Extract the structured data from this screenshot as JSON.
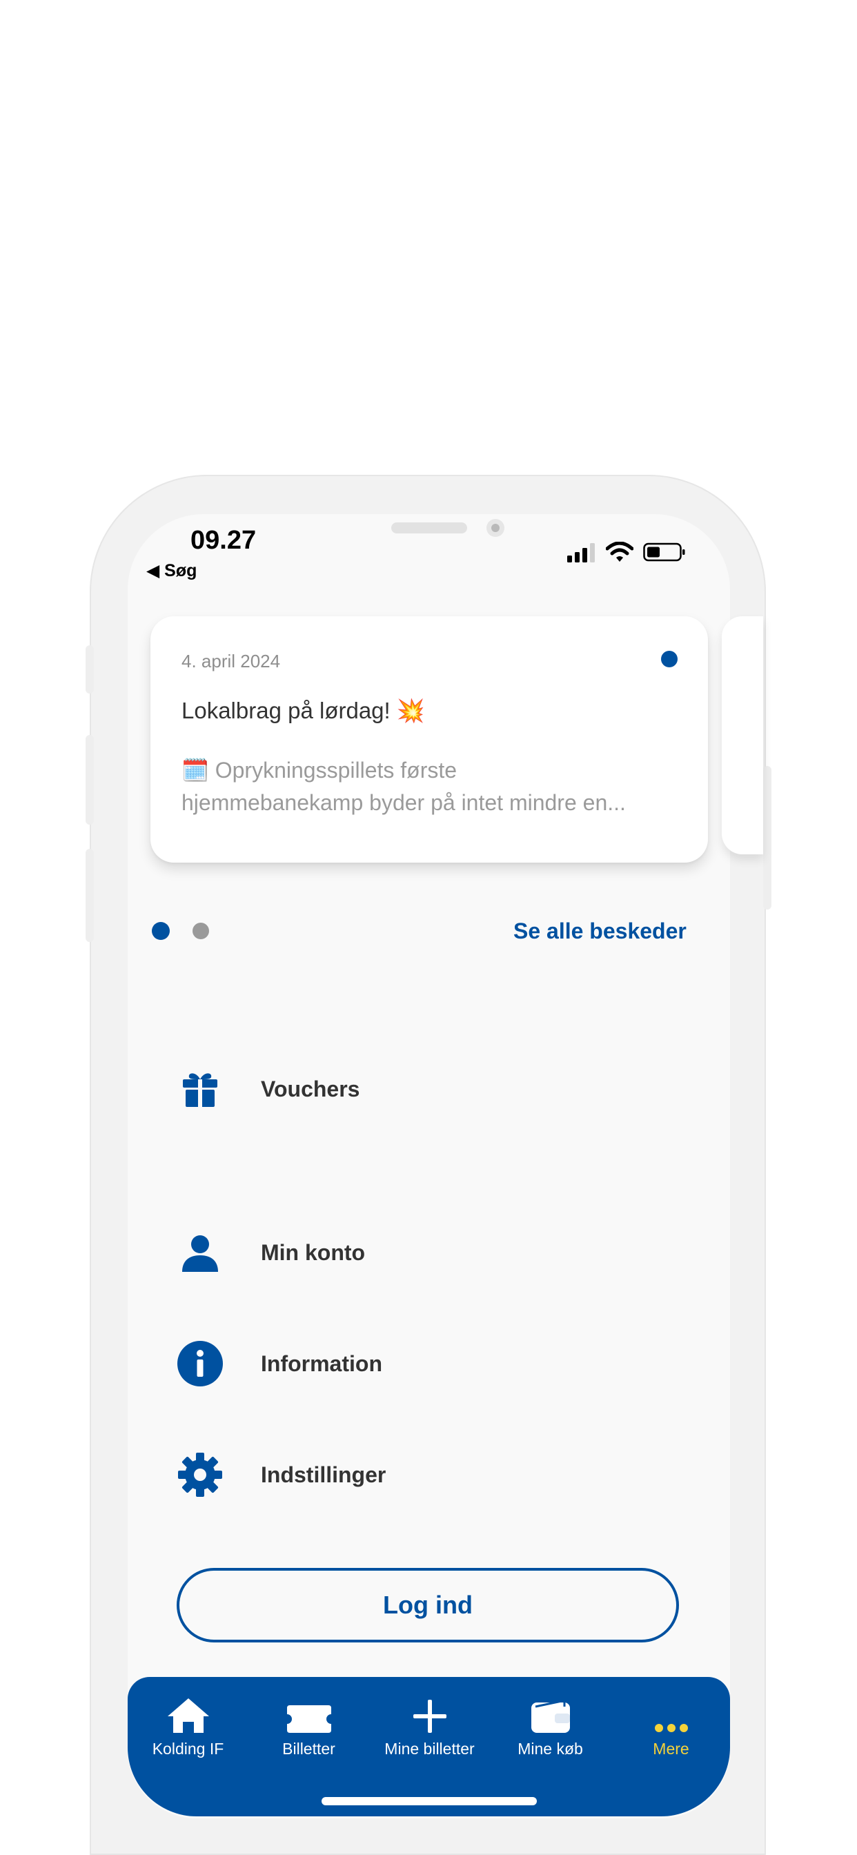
{
  "status_bar": {
    "time": "09.27",
    "back_label": "◀ Søg"
  },
  "message_card": {
    "date": "4. april 2024",
    "title": "Lokalbrag på lørdag! 💥",
    "body_line1": "🗓️ Oprykningsspillets første",
    "body_line2": "hjemmebanekamp byder på intet mindre en..."
  },
  "pager": {
    "see_all_label": "Se alle beskeder"
  },
  "menu": {
    "vouchers": "Vouchers",
    "my_account": "Min konto",
    "information": "Information",
    "settings": "Indstillinger"
  },
  "login_label": "Log ind",
  "tabs": [
    {
      "label": "Kolding IF",
      "icon": "home-icon"
    },
    {
      "label": "Billetter",
      "icon": "ticket-icon"
    },
    {
      "label": "Mine billetter",
      "icon": "plus-icon"
    },
    {
      "label": "Mine køb",
      "icon": "wallet-icon"
    },
    {
      "label": "Mere",
      "icon": "more-icon"
    }
  ],
  "colors": {
    "brand": "#0051a0",
    "active_tab": "#f5d33a",
    "background": "#f9f9f9"
  }
}
